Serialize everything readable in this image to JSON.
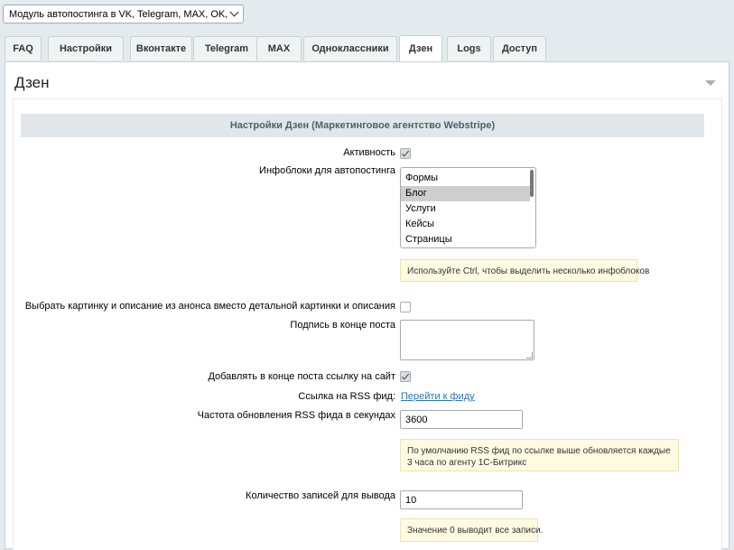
{
  "module_select": {
    "value": "Модуль автопостинга в VK, Telegram, MAX, OK, Дзен"
  },
  "tabs": [
    {
      "label": "FAQ"
    },
    {
      "label": "Настройки"
    },
    {
      "label": "Вконтакте"
    },
    {
      "label": "Telegram"
    },
    {
      "label": "MAX"
    },
    {
      "label": "Одноклассники"
    },
    {
      "label": "Дзен"
    },
    {
      "label": "Logs"
    },
    {
      "label": "Доступ"
    }
  ],
  "active_tab": "Дзен",
  "panel": {
    "title": "Дзен"
  },
  "section_header": "Настройки Дзен (Маркетинговое агентство Webstripe)",
  "fields": {
    "active": {
      "label": "Активность",
      "checked": true
    },
    "iblocks": {
      "label": "Инфоблоки для автопостинга",
      "options": [
        "Формы",
        "Блог",
        "Услуги",
        "Кейсы",
        "Страницы"
      ],
      "selected": "Блог",
      "hint": "Используйте Ctrl, чтобы выделить несколько инфоблоков"
    },
    "use_preview": {
      "label": "Выбрать картинку и описание из анонса вместо детальной картинки и описания",
      "checked": false
    },
    "signature": {
      "label": "Подпись в конце поста",
      "value": ""
    },
    "add_link": {
      "label": "Добавлять в конце поста ссылку на сайт",
      "checked": true
    },
    "rss_link": {
      "label": "Ссылка на RSS фид:",
      "link_text": "Перейти к фиду"
    },
    "rss_interval": {
      "label": "Частота обновления RSS фида в секундах",
      "value": "3600",
      "hint": "По умолчанию RSS фид по ссылке выше обновляется каждые 3 часа по агенту 1С-Битрикс"
    },
    "records_count": {
      "label": "Количество записей для вывода",
      "value": "10",
      "hint": "Значение 0 выводит все записи."
    }
  },
  "colors": {
    "background": "#e4ebef",
    "section_header_bg": "#e0e6e9",
    "hint_bg": "#fefbe2",
    "link": "#2775c9"
  }
}
